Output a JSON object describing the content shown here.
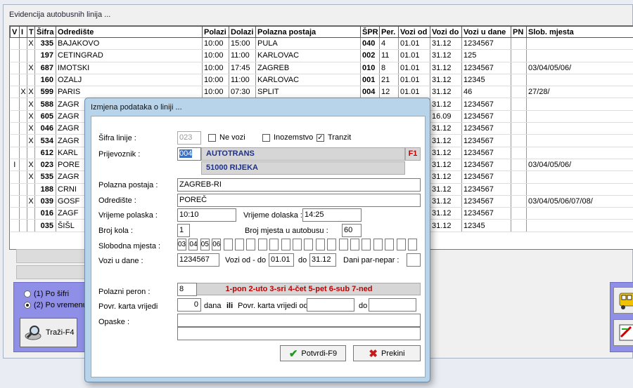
{
  "window": {
    "title": "Evidencija autobusnih linija ..."
  },
  "table": {
    "columns": [
      "V",
      "I",
      "T",
      "Šifra",
      "Odredište",
      "Polazi",
      "Dolazi",
      "Polazna postaja",
      "ŠPR",
      "Per.",
      "Vozi od",
      "Vozi do",
      "Vozi u dane",
      "PN",
      "Slob. mjesta"
    ],
    "rows": [
      {
        "v": "",
        "i": "",
        "t": "X",
        "sifra": "335",
        "odrediste": "BAJAKOVO",
        "polazi": "10:00",
        "dolazi": "15:00",
        "postaja": "PULA",
        "spr": "040",
        "per": "4",
        "od": "01.01",
        "do": "31.12",
        "dane": "1234567",
        "pn": "",
        "slob": ""
      },
      {
        "v": "",
        "i": "",
        "t": "",
        "sifra": "197",
        "odrediste": "CETINGRAD",
        "polazi": "10:00",
        "dolazi": "11:00",
        "postaja": "KARLOVAC",
        "spr": "002",
        "per": "11",
        "od": "01.01",
        "do": "31.12",
        "dane": "125",
        "pn": "",
        "slob": ""
      },
      {
        "v": "",
        "i": "",
        "t": "X",
        "sifra": "687",
        "odrediste": "IMOTSKI",
        "polazi": "10:00",
        "dolazi": "17:45",
        "postaja": "ZAGREB",
        "spr": "010",
        "per": "8",
        "od": "01.01",
        "do": "31.12",
        "dane": "1234567",
        "pn": "",
        "slob": "03/04/05/06/"
      },
      {
        "v": "",
        "i": "",
        "t": "",
        "sifra": "160",
        "odrediste": "OZALJ",
        "polazi": "10:00",
        "dolazi": "11:00",
        "postaja": "KARLOVAC",
        "spr": "001",
        "per": "21",
        "od": "01.01",
        "do": "31.12",
        "dane": "12345",
        "pn": "",
        "slob": ""
      },
      {
        "v": "",
        "i": "X",
        "t": "X",
        "sifra": "599",
        "odrediste": "PARIS",
        "polazi": "10:00",
        "dolazi": "07:30",
        "postaja": "SPLIT",
        "spr": "004",
        "per": "12",
        "od": "01.01",
        "do": "31.12",
        "dane": "46",
        "pn": "",
        "slob": "27/28/"
      },
      {
        "v": "",
        "i": "",
        "t": "X",
        "sifra": "588",
        "odrediste": "ZAGR",
        "polazi": "",
        "dolazi": "",
        "postaja": "",
        "spr": "",
        "per": "",
        "od": "",
        "do": "31.12",
        "dane": "1234567",
        "pn": "",
        "slob": ""
      },
      {
        "v": "",
        "i": "",
        "t": "X",
        "sifra": "605",
        "odrediste": "ZAGR",
        "polazi": "",
        "dolazi": "",
        "postaja": "",
        "spr": "",
        "per": "",
        "od": "",
        "do": "16.09",
        "dane": "1234567",
        "pn": "",
        "slob": ""
      },
      {
        "v": "",
        "i": "",
        "t": "X",
        "sifra": "046",
        "odrediste": "ZAGR",
        "polazi": "",
        "dolazi": "",
        "postaja": "",
        "spr": "",
        "per": "",
        "od": "",
        "do": "31.12",
        "dane": "1234567",
        "pn": "",
        "slob": ""
      },
      {
        "v": "",
        "i": "",
        "t": "X",
        "sifra": "534",
        "odrediste": "ZAGR",
        "polazi": "",
        "dolazi": "",
        "postaja": "",
        "spr": "",
        "per": "",
        "od": "",
        "do": "31.12",
        "dane": "1234567",
        "pn": "",
        "slob": ""
      },
      {
        "v": "",
        "i": "",
        "t": "",
        "sifra": "612",
        "odrediste": "KARL",
        "polazi": "",
        "dolazi": "",
        "postaja": "",
        "spr": "",
        "per": "",
        "od": "",
        "do": "31.12",
        "dane": "1234567",
        "pn": "",
        "slob": ""
      },
      {
        "v": "I",
        "i": "",
        "t": "X",
        "sifra": "023",
        "odrediste": "PORE",
        "polazi": "",
        "dolazi": "",
        "postaja": "",
        "spr": "",
        "per": "",
        "od": "",
        "do": "31.12",
        "dane": "1234567",
        "pn": "",
        "slob": "03/04/05/06/"
      },
      {
        "v": "",
        "i": "",
        "t": "X",
        "sifra": "535",
        "odrediste": "ZAGR",
        "polazi": "",
        "dolazi": "",
        "postaja": "",
        "spr": "",
        "per": "",
        "od": "",
        "do": "31.12",
        "dane": "1234567",
        "pn": "",
        "slob": ""
      },
      {
        "v": "",
        "i": "",
        "t": "",
        "sifra": "188",
        "odrediste": "CRNI",
        "polazi": "",
        "dolazi": "",
        "postaja": "",
        "spr": "",
        "per": "",
        "od": "",
        "do": "31.12",
        "dane": "1234567",
        "pn": "",
        "slob": ""
      },
      {
        "v": "",
        "i": "",
        "t": "X",
        "sifra": "039",
        "odrediste": "GOSF",
        "polazi": "",
        "dolazi": "",
        "postaja": "",
        "spr": "",
        "per": "",
        "od": "",
        "do": "31.12",
        "dane": "1234567",
        "pn": "",
        "slob": "03/04/05/06/07/08/"
      },
      {
        "v": "",
        "i": "",
        "t": "",
        "sifra": "016",
        "odrediste": "ZAGF",
        "polazi": "",
        "dolazi": "",
        "postaja": "",
        "spr": "",
        "per": "",
        "od": "",
        "do": "31.12",
        "dane": "1234567",
        "pn": "",
        "slob": ""
      },
      {
        "v": "",
        "i": "",
        "t": "",
        "sifra": "035",
        "odrediste": "ŠIŠL",
        "polazi": "",
        "dolazi": "",
        "postaja": "",
        "spr": "",
        "per": "",
        "od": "",
        "do": "31.12",
        "dane": "12345",
        "pn": "",
        "slob": ""
      }
    ]
  },
  "sort": {
    "option1": "(1) Po šifri",
    "option2": "(2) Po vremenu p",
    "selected": 2
  },
  "search_button": "Traži-F4",
  "dialog": {
    "title": "Izmjena podataka o liniji ...",
    "sifra_label": "Šifra linije :",
    "sifra_value": "023",
    "ne_vozi_label": "Ne vozi",
    "inozemstvo_label": "Inozemstvo",
    "tranzit_label": "Tranzit",
    "tranzit_checked": "✓",
    "prijevoznik_label": "Prijevoznik :",
    "prijevoznik_code": "004",
    "prijevoznik_name": "AUTOTRANS",
    "prijevoznik_city": "51000 RIJEKA",
    "f1_label": "F1",
    "polazna_label": "Polazna postaja :",
    "polazna_value": "ZAGREB-RI",
    "odrediste_label": "Odredište :",
    "odrediste_value": "POREČ",
    "vrijeme_polaska_label": "Vrijeme polaska :",
    "vrijeme_polaska_value": "10:10",
    "vrijeme_dolaska_label": "Vrijeme dolaska :",
    "vrijeme_dolaska_value": "14:25",
    "broj_kola_label": "Broj kola :",
    "broj_kola_value": "1",
    "broj_mjesta_label": "Broj mjesta u autobusu :",
    "broj_mjesta_value": "60",
    "slobodna_label": "Slobodna mjesta :",
    "slobodna_values": [
      "03",
      "04",
      "05",
      "06",
      "",
      "",
      "",
      "",
      "",
      "",
      "",
      "",
      "",
      "",
      "",
      "",
      "",
      "",
      "",
      "",
      ""
    ],
    "vozi_u_dane_label": "Vozi u dane :",
    "vozi_u_dane_value": "1234567",
    "vozi_od_do_label": "Vozi od - do :",
    "vozi_od_value": "01.01",
    "do_label": "do",
    "vozi_do_value": "31.12",
    "dani_par_label": "Dani par-nepar :",
    "days_legend": "1-pon  2-uto  3-sri  4-čet  5-pet  6-sub  7-ned",
    "peron_label": "Polazni peron :",
    "peron_value": "8",
    "povr_label": "Povr. karta vrijedi",
    "povr_value": "0",
    "dana_label": "dana",
    "ili_label": "ili",
    "povr_od_label": "Povr. karta vrijedi od",
    "povr_do_label": "do",
    "opaske_label": "Opaske :",
    "confirm_label": "Potvrdi-F9",
    "cancel_label": "Prekini"
  }
}
